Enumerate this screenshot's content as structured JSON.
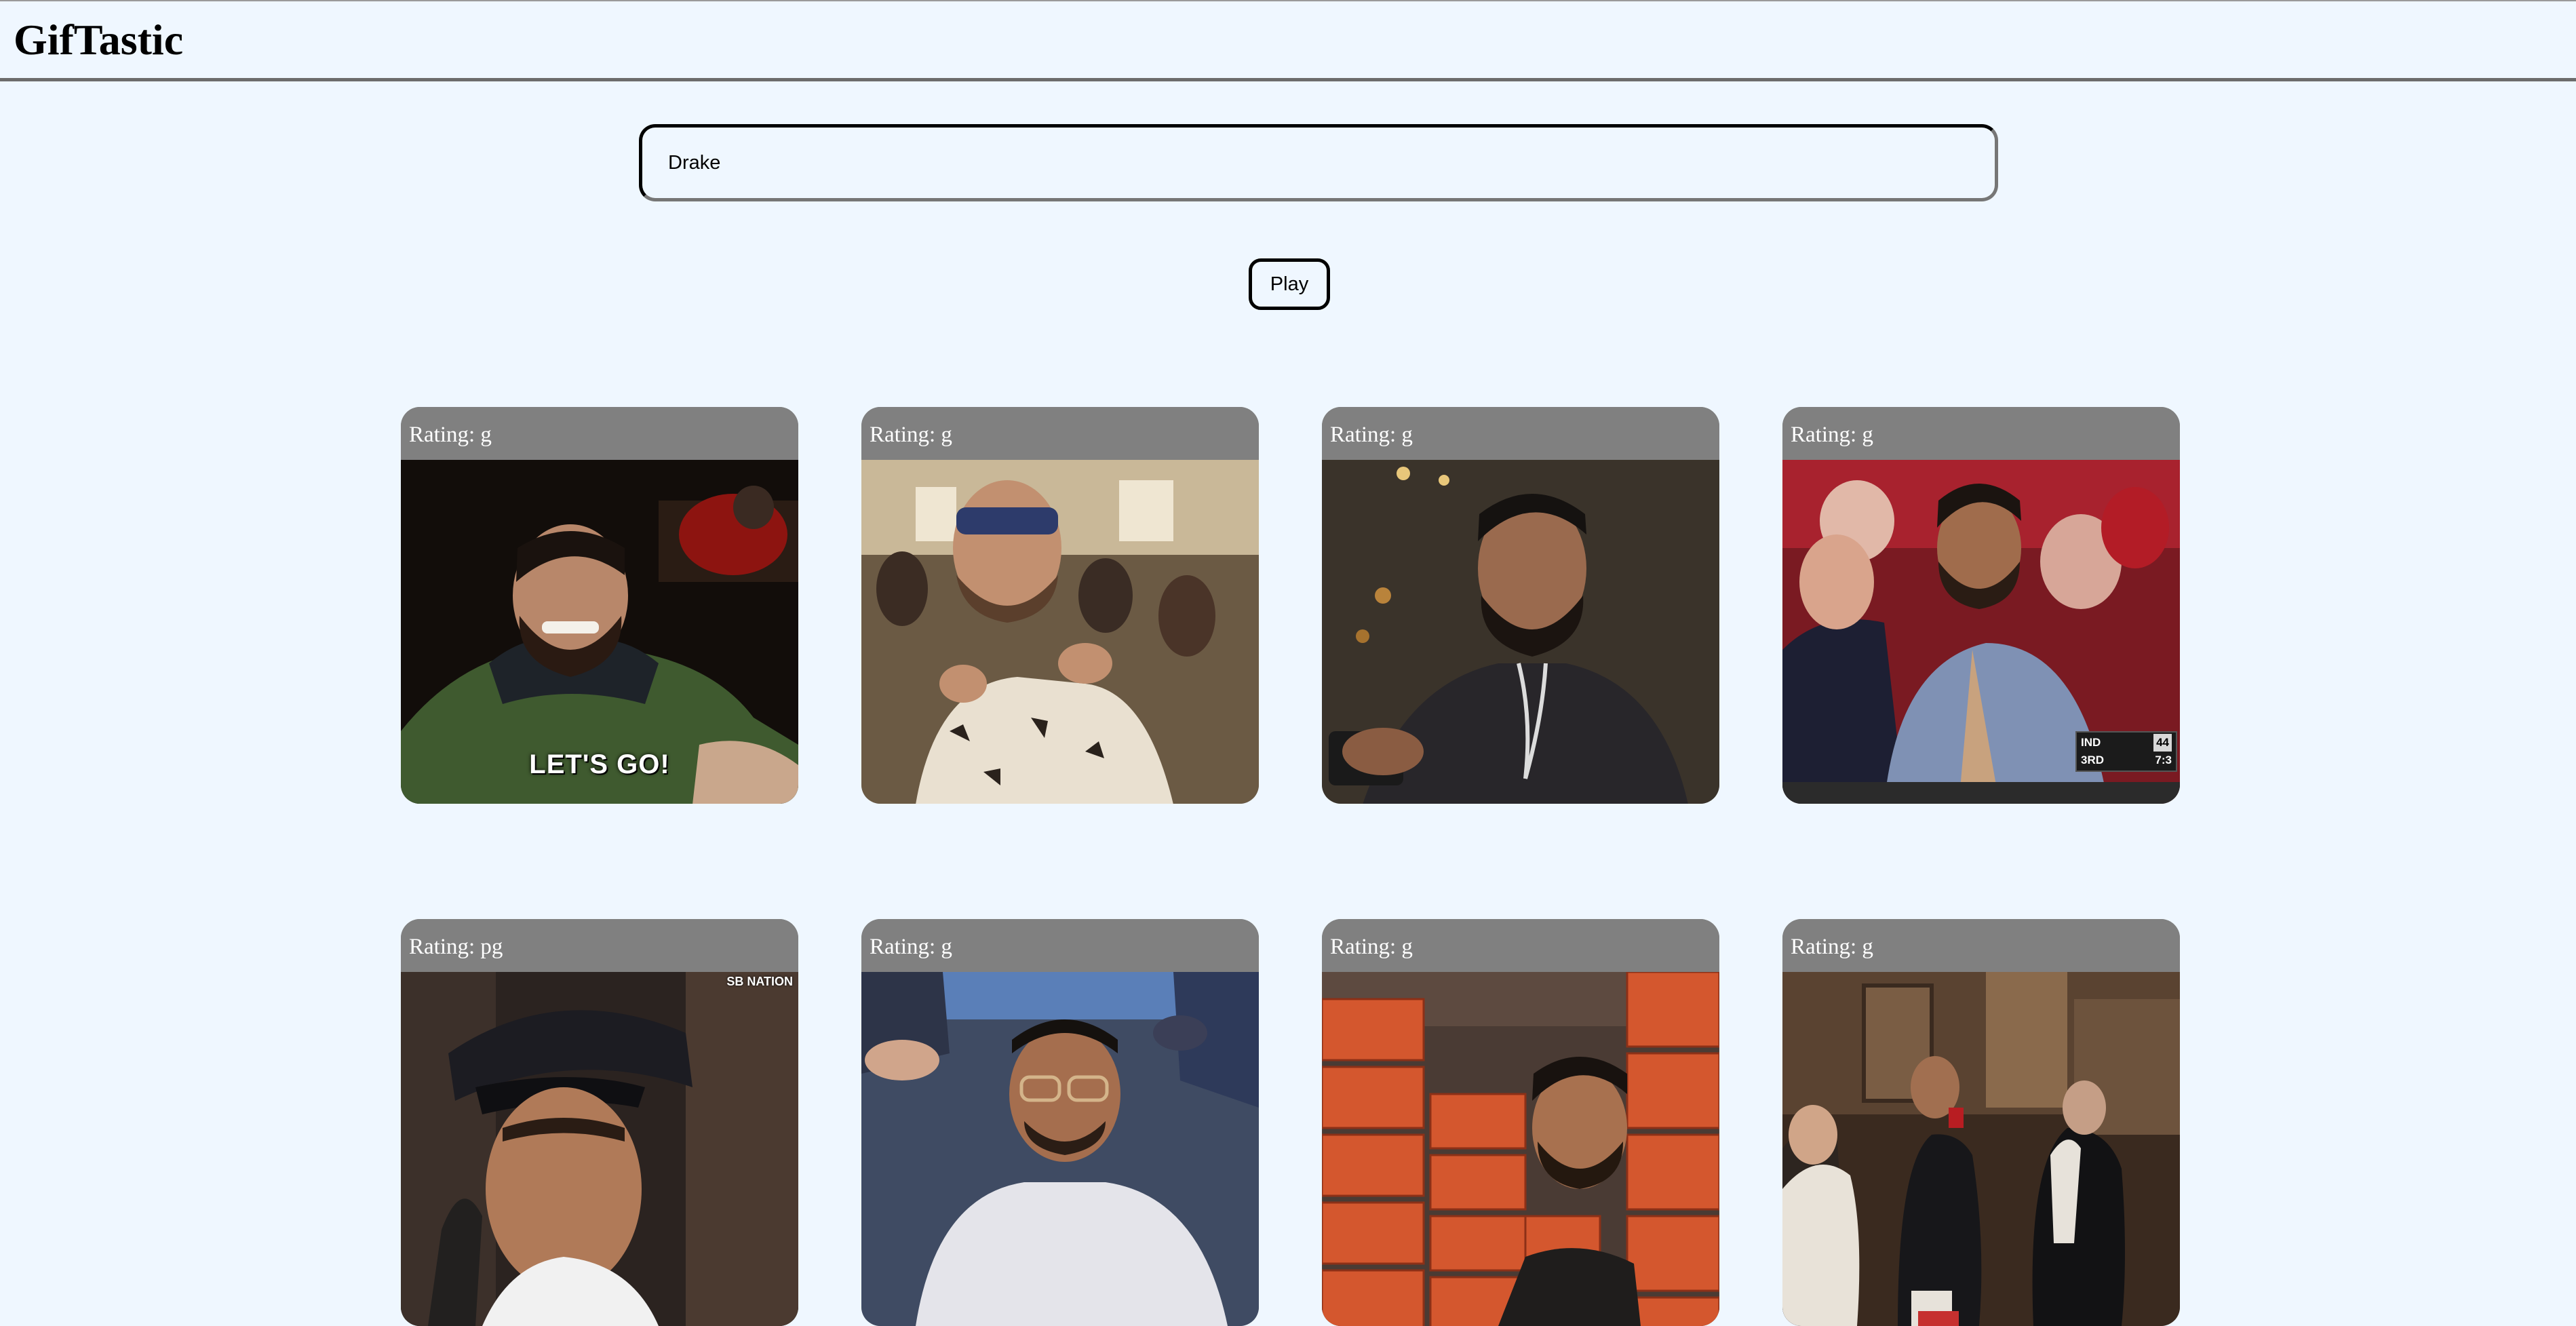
{
  "app": {
    "title": "GifTastic"
  },
  "search": {
    "value": "Drake",
    "placeholder": ""
  },
  "controls": {
    "play_label": "Play"
  },
  "gifs": [
    {
      "rating": "Rating: g",
      "overlay_text": "LET'S GO!"
    },
    {
      "rating": "Rating: g"
    },
    {
      "rating": "Rating: g"
    },
    {
      "rating": "Rating: g",
      "scorebug": {
        "team": "IND",
        "score": "44",
        "period": "3RD",
        "clock": "7:3"
      }
    },
    {
      "rating": "Rating: pg",
      "watermark": "SB NATION"
    },
    {
      "rating": "Rating: g"
    },
    {
      "rating": "Rating: g"
    },
    {
      "rating": "Rating: g"
    }
  ],
  "colors": {
    "page_background": "#eff7ff",
    "card_header": "#808080",
    "rating_text": "#ffffff"
  }
}
